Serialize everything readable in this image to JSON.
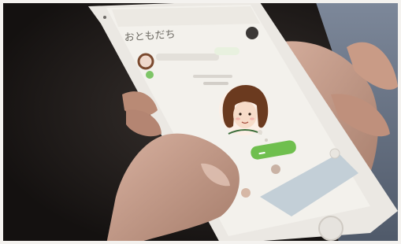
{
  "photo": {
    "subject": "hand-holding-smartphone",
    "colors": {
      "background": "#1a1614",
      "phone_body": "#ece9e4",
      "screen_bg": "#f3f1ec",
      "accent_green": "#6fbf4e",
      "skin": "#c99b86",
      "shirt": "#6a7788"
    }
  },
  "app": {
    "header_title": "おともだち",
    "search_placeholder": "",
    "profile_caption": "",
    "cta_label": "",
    "icons": [
      "menu-icon",
      "avatar-icon"
    ]
  }
}
